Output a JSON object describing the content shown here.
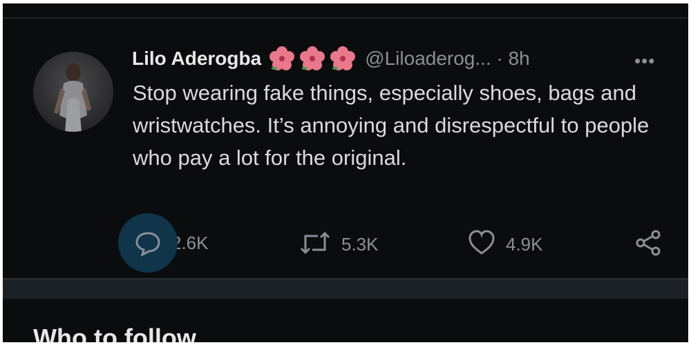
{
  "tweet": {
    "display_name": "Lilo Aderogba",
    "emoji_names": [
      "hibiscus-icon",
      "hibiscus-icon",
      "hibiscus-icon"
    ],
    "handle_time": "@Liloaderog... · 8h",
    "more_label": "•••",
    "text": "Stop wearing fake things, especially shoes, bags and wristwatches. It’s annoying and disrespectful to people who pay a lot for the original.",
    "reply_count": "2.6K",
    "retweet_count": "5.3K",
    "like_count": "4.9K"
  },
  "who_to_follow": {
    "title": "Who to follow"
  },
  "colors": {
    "background": "#0b0c0e",
    "text": "#d9dbde",
    "muted": "#8b9096",
    "reply_highlight": "#10344a",
    "hibiscus": "#e8788a"
  }
}
